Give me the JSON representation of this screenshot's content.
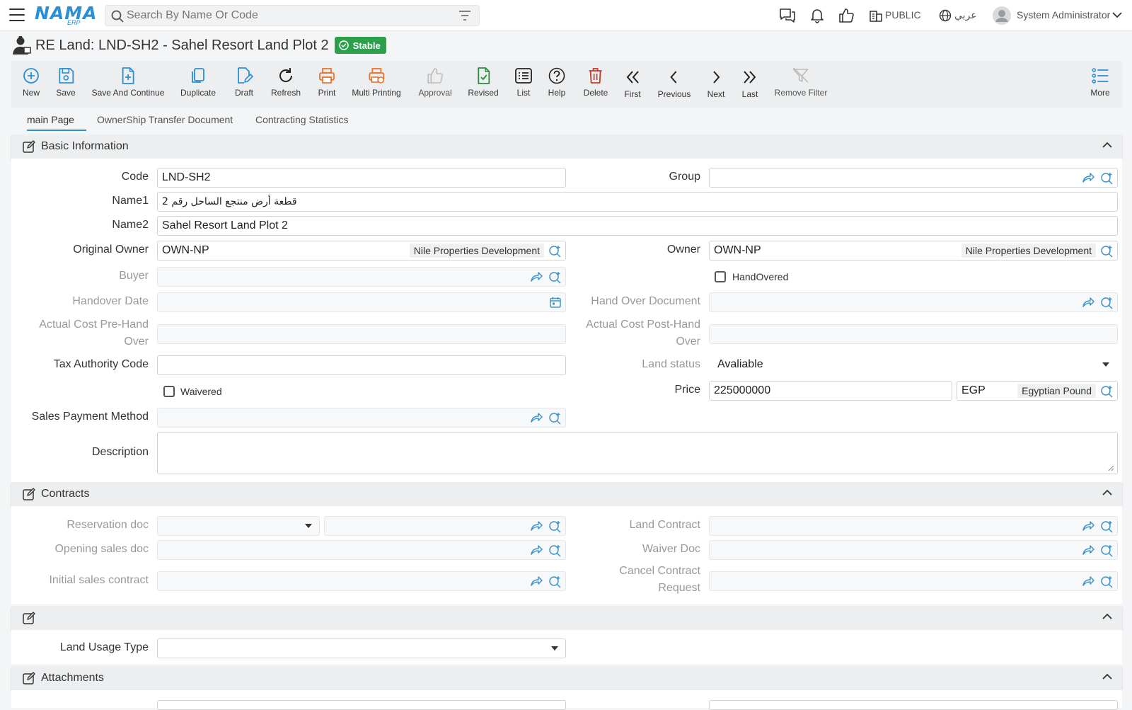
{
  "header": {
    "search_placeholder": "Search By Name Or Code",
    "branch": "PUBLIC",
    "language": "عربي",
    "user": "System Administrator"
  },
  "page": {
    "title": "RE Land: LND-SH2 - Sahel Resort Land Plot 2",
    "status": "Stable"
  },
  "toolbar": [
    {
      "label": "New",
      "icon": "plus-circle-icon"
    },
    {
      "label": "Save",
      "icon": "save-icon"
    },
    {
      "label": "Save And Continue",
      "icon": "file-plus-icon"
    },
    {
      "label": "Duplicate",
      "icon": "copy-icon"
    },
    {
      "label": "Draft",
      "icon": "draft-edit-icon"
    },
    {
      "label": "Refresh",
      "icon": "refresh-icon"
    },
    {
      "label": "Print",
      "icon": "printer-icon"
    },
    {
      "label": "Multi Printing",
      "icon": "multi-printer-icon"
    },
    {
      "label": "Approval",
      "icon": "thumbs-up-icon"
    },
    {
      "label": "Revised",
      "icon": "file-check-icon"
    },
    {
      "label": "List",
      "icon": "list-icon"
    },
    {
      "label": "Help",
      "icon": "help-icon"
    },
    {
      "label": "Delete",
      "icon": "trash-icon"
    },
    {
      "label": "First",
      "icon": "double-chevron-left-icon"
    },
    {
      "label": "Previous",
      "icon": "chevron-left-icon"
    },
    {
      "label": "Next",
      "icon": "chevron-right-icon"
    },
    {
      "label": "Last",
      "icon": "double-chevron-right-icon"
    },
    {
      "label": "Remove Filter",
      "icon": "filter-off-icon"
    },
    {
      "label": "More",
      "icon": "more-list-icon"
    }
  ],
  "tabs": [
    "main Page",
    "OwnerShip Transfer Document",
    "Contracting Statistics"
  ],
  "basic": {
    "title": "Basic Information",
    "code_label": "Code",
    "code": "LND-SH2",
    "group_label": "Group",
    "group": "",
    "name1_label": "Name1",
    "name1": "قطعة أرض منتجع الساحل رقم 2",
    "name2_label": "Name2",
    "name2": "Sahel Resort Land Plot 2",
    "orig_owner_label": "Original Owner",
    "orig_owner_code": "OWN-NP",
    "orig_owner_name": "Nile Properties Development",
    "owner_label": "Owner",
    "owner_code": "OWN-NP",
    "owner_name": "Nile Properties Development",
    "buyer_label": "Buyer",
    "buyer": "",
    "handovered_label": "HandOvered",
    "handover_date_label": "Handover Date",
    "handover_date": "",
    "handover_doc_label": "Hand Over Document",
    "handover_doc": "",
    "cost_pre_label_1": "Actual Cost Pre-Hand",
    "cost_pre_label_2": "Over",
    "cost_post_label_1": "Actual Cost Post-Hand",
    "cost_post_label_2": "Over",
    "tax_label": "Tax Authority Code",
    "tax": "",
    "land_status_label": "Land status",
    "land_status": "Avaliable",
    "waivered_label": "Waivered",
    "price_label": "Price",
    "price": "225000000",
    "currency_code": "EGP",
    "currency_name": "Egyptian Pound",
    "payment_label": "Sales Payment Method",
    "payment": "",
    "description_label": "Description",
    "description": ""
  },
  "contracts": {
    "title": "Contracts",
    "reservation_label": "Reservation doc",
    "land_contract_label": "Land Contract",
    "opening_label": "Opening sales doc",
    "waiver_label": "Waiver Doc",
    "initial_label": "Initial sales contract",
    "cancel_label_1": "Cancel Contract",
    "cancel_label_2": "Request"
  },
  "usage": {
    "title": "",
    "land_usage_label": "Land Usage Type",
    "land_usage": ""
  },
  "attachments": {
    "title": "Attachments"
  },
  "colors": {
    "accent": "#2a8fd3",
    "badge": "#2aa14a",
    "print": "#e8742b",
    "revised": "#2b8a3e",
    "delete": "#c0392b",
    "link_icon": "#3d94c8"
  }
}
